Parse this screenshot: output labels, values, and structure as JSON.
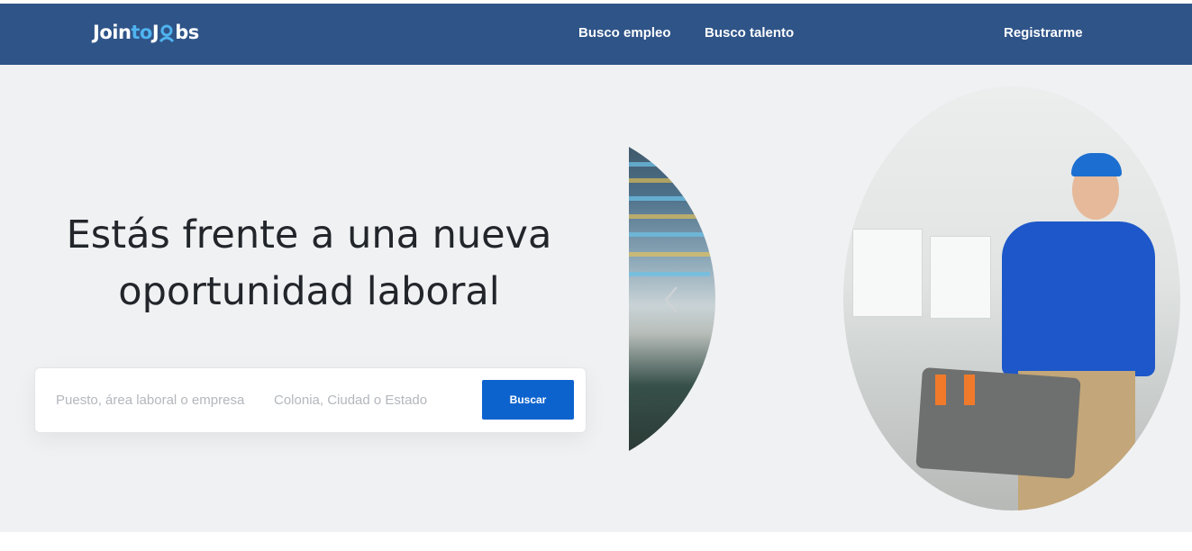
{
  "nav": {
    "logo_part1": "Join",
    "logo_part2": "to",
    "logo_part3": "J",
    "logo_part4": "bs",
    "links": [
      {
        "label": "Busco empleo"
      },
      {
        "label": "Busco talento"
      }
    ],
    "register_label": "Registrarme"
  },
  "hero": {
    "title_line1": "Estás frente a una nueva",
    "title_line2": "oportunidad laboral"
  },
  "search": {
    "job_placeholder": "Puesto, área laboral o empresa",
    "location_placeholder": "Colonia, Ciudad o Estado",
    "button_label": "Buscar"
  },
  "carousel": {
    "prev_icon": "chevron-left-icon"
  },
  "colors": {
    "nav_bg": "#2f5488",
    "accent": "#4fb3ef",
    "button": "#0d63ce",
    "hero_bg": "#f0f1f3"
  }
}
